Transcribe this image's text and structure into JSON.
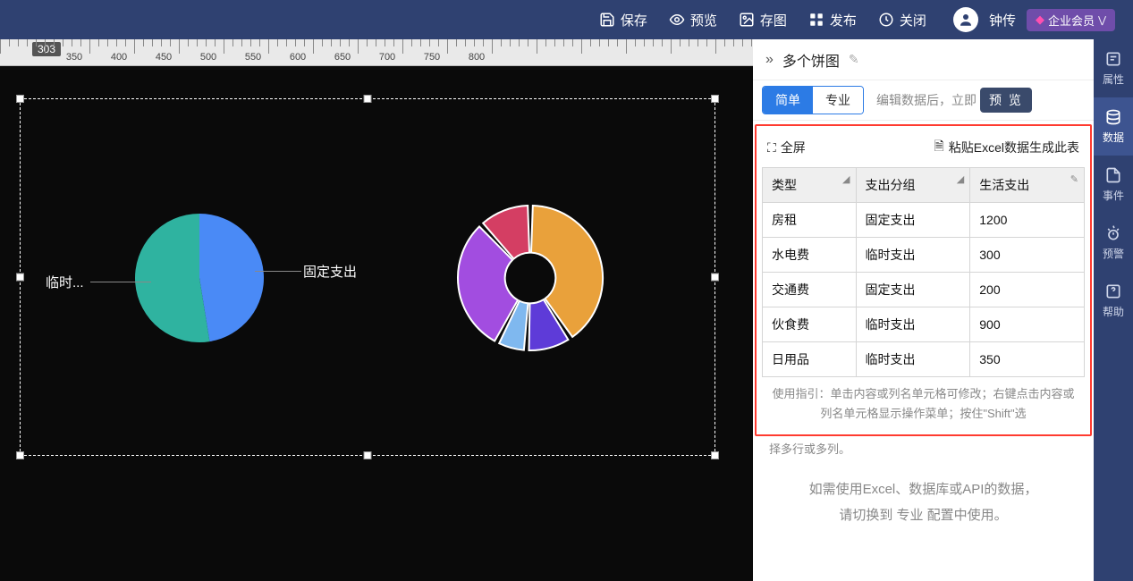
{
  "topbar": {
    "save": "保存",
    "preview": "预览",
    "save_image": "存图",
    "publish": "发布",
    "close": "关闭",
    "username": "钟传",
    "member": "企业会员"
  },
  "ruler": {
    "pos": "303"
  },
  "canvas": {
    "label_left": "临时...",
    "label_right": "固定支出"
  },
  "panel": {
    "title": "多个饼图",
    "tab_simple": "简单",
    "tab_pro": "专业",
    "hint1": "编辑数据后，立即",
    "preview_btn": "预 览",
    "fullscreen": "全屏",
    "paste": "粘贴Excel数据生成此表",
    "hint2": "使用指引：单击内容或列名单元格可修改；右键点击内容或列名单元格显示操作菜单；按住\"Shift\"选",
    "hint3": "择多行或多列。",
    "hint4_a": "如需使用Excel、数据库或API的数据，",
    "hint4_b": "请切换到 专业 配置中使用。"
  },
  "table": {
    "headers": [
      "类型",
      "支出分组",
      "生活支出"
    ],
    "rows": [
      [
        "房租",
        "固定支出",
        "1200"
      ],
      [
        "水电费",
        "临时支出",
        "300"
      ],
      [
        "交通费",
        "固定支出",
        "200"
      ],
      [
        "伙食费",
        "临时支出",
        "900"
      ],
      [
        "日用品",
        "临时支出",
        "350"
      ]
    ]
  },
  "rail": {
    "props": "属性",
    "data": "数据",
    "events": "事件",
    "alert": "预警",
    "help": "帮助"
  },
  "chart_data": [
    {
      "type": "pie",
      "title": "支出分组",
      "series": [
        {
          "name": "固定支出",
          "value": 1400,
          "color": "#4a8af6"
        },
        {
          "name": "临时支出",
          "value": 1550,
          "color": "#2fb3a0"
        }
      ]
    },
    {
      "type": "pie",
      "title": "生活支出明细",
      "inner_radius": 0.35,
      "padding_deg": 4,
      "series": [
        {
          "name": "房租",
          "value": 1200,
          "color": "#e9a13b"
        },
        {
          "name": "水电费",
          "value": 300,
          "color": "#5e3bd8"
        },
        {
          "name": "交通费",
          "value": 200,
          "color": "#7fb8ef"
        },
        {
          "name": "伙食费",
          "value": 900,
          "color": "#a24de0"
        },
        {
          "name": "日用品",
          "value": 350,
          "color": "#d43e63"
        }
      ]
    }
  ]
}
